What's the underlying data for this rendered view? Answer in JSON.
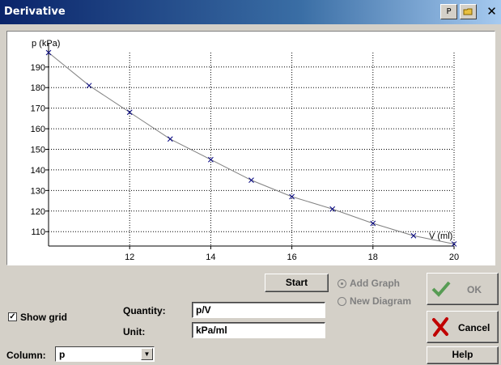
{
  "window": {
    "title": "Derivative",
    "p_button": "P",
    "close_glyph": "✕"
  },
  "chart_data": {
    "type": "scatter",
    "ylabel": "p (kPa)",
    "xlabel": "V (ml)",
    "xlim": [
      10,
      20
    ],
    "ylim": [
      103,
      197
    ],
    "x_ticks": [
      12,
      14,
      16,
      18,
      20
    ],
    "y_ticks": [
      110,
      120,
      130,
      140,
      150,
      160,
      170,
      180,
      190
    ],
    "grid": true,
    "series": [
      {
        "x": [
          10,
          11,
          12,
          13,
          14,
          15,
          16,
          17,
          18,
          19,
          20
        ],
        "y": [
          197,
          181,
          168,
          155,
          145,
          135,
          127,
          121,
          114,
          108,
          104
        ]
      }
    ],
    "marker": "x",
    "marker_color": "#00007f",
    "curve_color": "#808080"
  },
  "buttons": {
    "start": "Start",
    "ok": "OK",
    "cancel": "Cancel",
    "help": "Help"
  },
  "options": {
    "add_graph": "Add Graph",
    "new_diagram": "New Diagram",
    "show_grid": "Show grid",
    "show_grid_checked": true
  },
  "fields": {
    "quantity_label": "Quantity:",
    "quantity_value": "p/V",
    "unit_label": "Unit:",
    "unit_value": "kPa/ml",
    "column_label": "Column:",
    "column_value": "p"
  },
  "colors": {
    "title_start": "#0a246a",
    "title_end": "#a6caf0",
    "cancel_x": "#c00000",
    "ok_check": "#2e8b2e"
  }
}
